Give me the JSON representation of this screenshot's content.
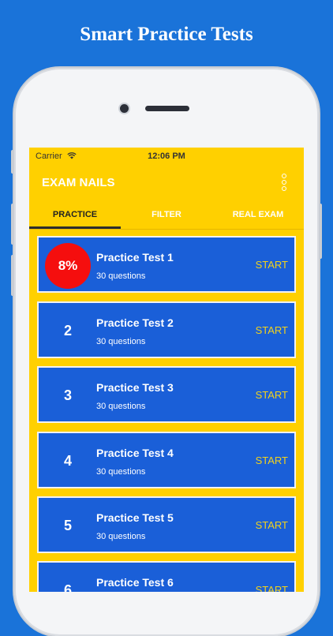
{
  "promo": {
    "title": "Smart Practice Tests"
  },
  "status_bar": {
    "carrier": "Carrier",
    "time": "12:06 PM"
  },
  "app_bar": {
    "title": "EXAM NAILS"
  },
  "tabs": [
    {
      "label": "PRACTICE",
      "active": true
    },
    {
      "label": "FILTER",
      "active": false
    },
    {
      "label": "REAL EXAM",
      "active": false
    }
  ],
  "tests": [
    {
      "badge": "8%",
      "title": "Practice Test 1",
      "subtitle": "30 questions",
      "action": "START"
    },
    {
      "badge": "2",
      "title": "Practice Test 2",
      "subtitle": "30 questions",
      "action": "START"
    },
    {
      "badge": "3",
      "title": "Practice Test 3",
      "subtitle": "30 questions",
      "action": "START"
    },
    {
      "badge": "4",
      "title": "Practice Test 4",
      "subtitle": "30 questions",
      "action": "START"
    },
    {
      "badge": "5",
      "title": "Practice Test 5",
      "subtitle": "30 questions",
      "action": "START"
    },
    {
      "badge": "6",
      "title": "Practice Test 6",
      "subtitle": "",
      "action": "START"
    }
  ],
  "colors": {
    "background": "#1a73d9",
    "app_bar": "#ffd000",
    "card": "#1a5fd8",
    "progress_badge": "#f50e0e",
    "start_text": "#f2d21b"
  }
}
